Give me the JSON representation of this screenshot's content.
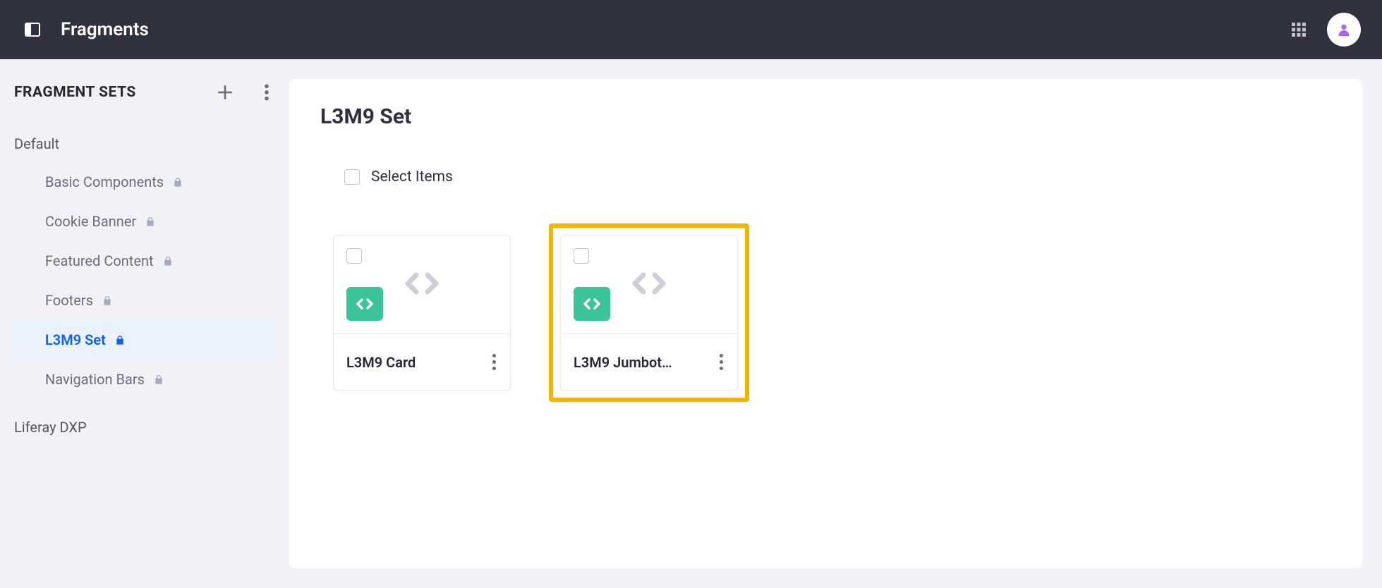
{
  "topbar": {
    "title": "Fragments"
  },
  "sidebar": {
    "title": "FRAGMENT SETS",
    "groups": [
      {
        "label": "Default",
        "items": [
          {
            "label": "Basic Components",
            "locked": true,
            "active": false
          },
          {
            "label": "Cookie Banner",
            "locked": true,
            "active": false
          },
          {
            "label": "Featured Content",
            "locked": true,
            "active": false
          },
          {
            "label": "Footers",
            "locked": true,
            "active": false
          },
          {
            "label": "L3M9 Set",
            "locked": true,
            "active": true
          },
          {
            "label": "Navigation Bars",
            "locked": true,
            "active": false
          }
        ]
      },
      {
        "label": "Liferay DXP",
        "items": []
      }
    ]
  },
  "main": {
    "title": "L3M9 Set",
    "select_label": "Select Items",
    "cards": [
      {
        "title": "L3M9 Card",
        "highlighted": false
      },
      {
        "title": "L3M9 Jumbot…",
        "highlighted": true
      }
    ]
  },
  "colors": {
    "accent": "#0b5fff",
    "highlight": "#f5b400",
    "badge": "#3bc49a"
  }
}
